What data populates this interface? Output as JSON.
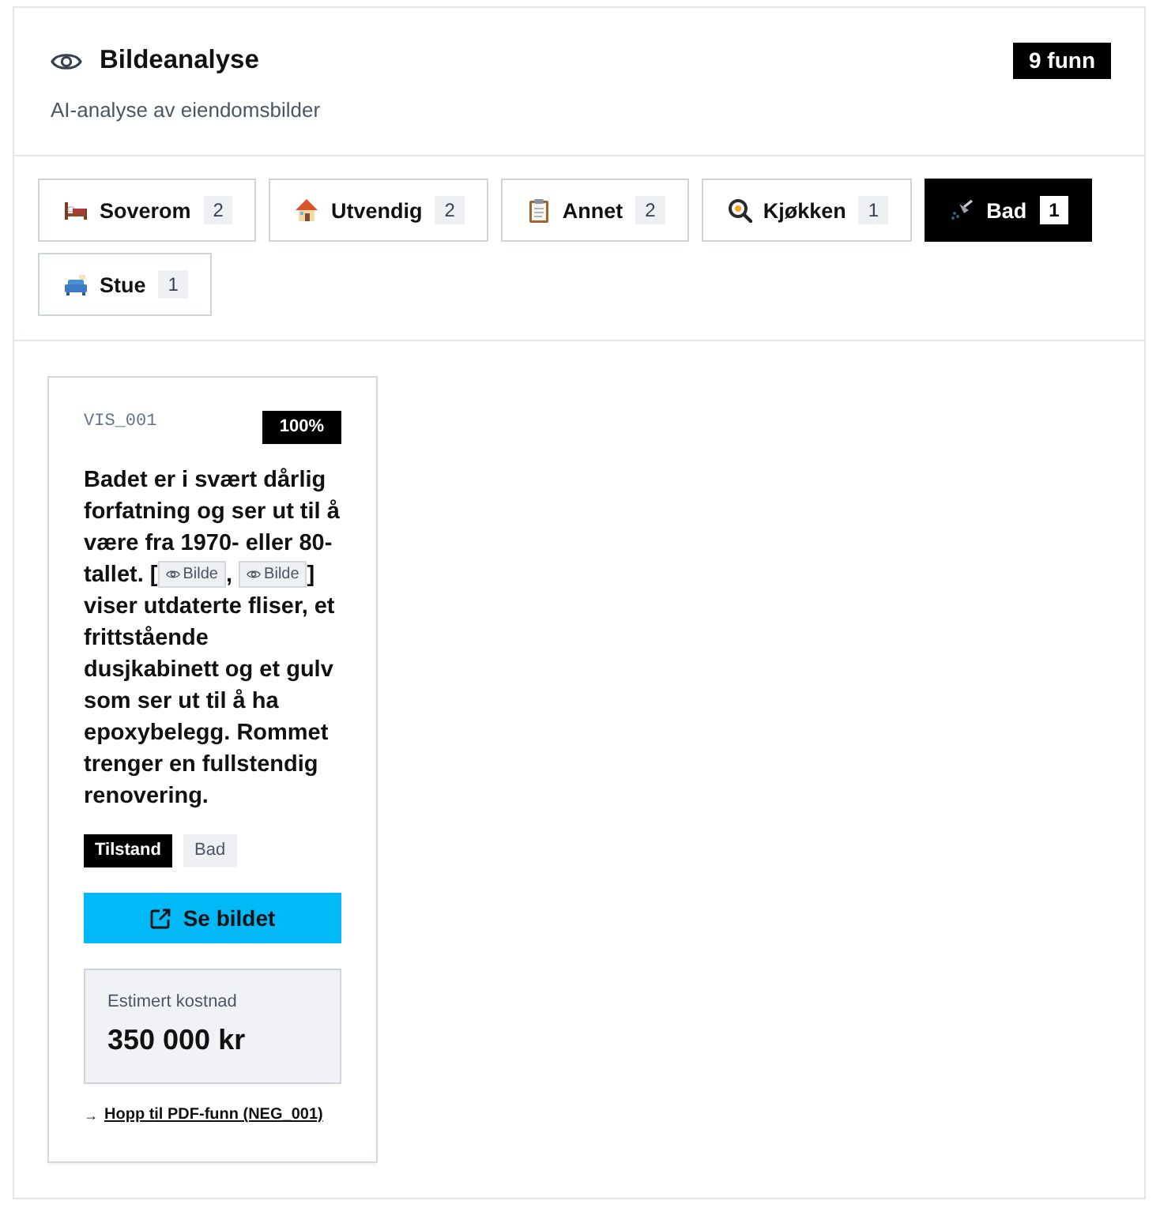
{
  "header": {
    "title": "Bildeanalyse",
    "subtitle": "AI-analyse av eiendomsbilder",
    "badge": "9 funn"
  },
  "tabs": [
    {
      "label": "Soverom",
      "count": "2",
      "selected": false
    },
    {
      "label": "Utvendig",
      "count": "2",
      "selected": false
    },
    {
      "label": "Annet",
      "count": "2",
      "selected": false
    },
    {
      "label": "Kjøkken",
      "count": "1",
      "selected": false
    },
    {
      "label": "Bad",
      "count": "1",
      "selected": true
    },
    {
      "label": "Stue",
      "count": "1",
      "selected": false
    }
  ],
  "findings": [
    {
      "id": "VIS_001",
      "confidence": "100%",
      "description": [
        {
          "kind": "text",
          "text": "Badet er i svært dårlig forfatning og ser ut til å være fra 1970- eller 80-tallet. ["
        },
        {
          "kind": "image_ref",
          "label": "Bilde"
        },
        {
          "kind": "text",
          "text": ", "
        },
        {
          "kind": "image_ref",
          "label": "Bilde"
        },
        {
          "kind": "text",
          "text": "] viser utdaterte fliser, et frittstående dusjkabinett og et gulv som ser ut til å ha epoxybelegg. Rommet trenger en fullstendig renovering."
        }
      ],
      "tags": [
        {
          "label": "Tilstand",
          "kind": "category"
        },
        {
          "label": "Bad",
          "kind": "room"
        }
      ],
      "button": "Se bildet",
      "cost": {
        "label": "Estimert kostnad",
        "value": "350 000 kr"
      },
      "link": {
        "arrow": "→",
        "text": "Hopp til PDF-funn (NEG_001)"
      }
    }
  ]
}
